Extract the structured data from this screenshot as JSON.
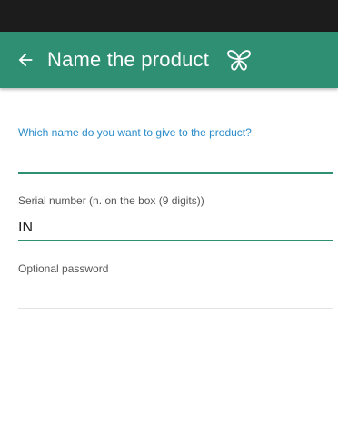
{
  "app_bar": {
    "title": "Name the product",
    "back_icon": "arrow-left-icon",
    "logo_icon": "butterfly-logo-icon",
    "color": "#2e8f72"
  },
  "form": {
    "name_prompt": "Which name do you want to give to the product?",
    "serial_label": "Serial number (n. on the box (9 digits))",
    "serial_value": "IN",
    "password_label": "Optional password"
  },
  "colors": {
    "accent": "#2e8f72",
    "prompt_blue": "#2a8cc9",
    "status_bar": "#1c1c1c"
  }
}
